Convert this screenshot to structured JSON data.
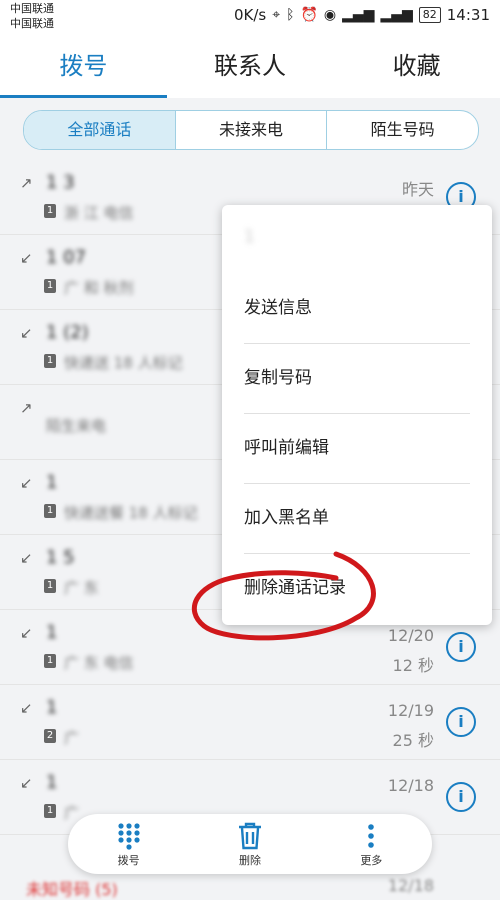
{
  "status_bar": {
    "carrier_1": "中国联通",
    "carrier_2": "中国联通",
    "speed": "0K/s",
    "battery": "82",
    "time": "14:31"
  },
  "tabs": [
    {
      "label": "拨号",
      "active": true
    },
    {
      "label": "联系人",
      "active": false
    },
    {
      "label": "收藏",
      "active": false
    }
  ],
  "filter": [
    {
      "label": "全部通话",
      "active": true
    },
    {
      "label": "未接来电",
      "active": false
    },
    {
      "label": "陌生号码",
      "active": false
    }
  ],
  "calls": [
    {
      "name": "1 3",
      "sim": "1",
      "sub": "浙 江 电信",
      "date": "昨天",
      "duration": ""
    },
    {
      "name": "1 07",
      "sim": "1",
      "sub": "广 和 秋剂",
      "date": "",
      "duration": ""
    },
    {
      "name": "1 (2)",
      "sim": "1",
      "sub": "快递送 18 人标记",
      "date": "",
      "duration": ""
    },
    {
      "name": "",
      "sim": "",
      "sub": "陌生来电",
      "date": "",
      "duration": ""
    },
    {
      "name": "1",
      "sim": "1",
      "sub": "快递送餐 18 人标记",
      "date": "",
      "duration": ""
    },
    {
      "name": "1 5",
      "sim": "1",
      "sub": "广 东",
      "date": "",
      "duration": ""
    },
    {
      "name": "1",
      "sim": "1",
      "sub": "广 东 电信",
      "date": "12/20",
      "duration": "12 秒"
    },
    {
      "name": "1",
      "sim": "2",
      "sub": "广",
      "date": "12/19",
      "duration": "25 秒"
    },
    {
      "name": "1",
      "sim": "1",
      "sub": "广",
      "date": "12/18",
      "duration": ""
    }
  ],
  "context_menu": {
    "header": "1",
    "items": [
      "发送信息",
      "复制号码",
      "呼叫前编辑",
      "加入黑名单",
      "删除通话记录"
    ]
  },
  "toolbar": {
    "dial_label": "拨号",
    "delete_label": "删除",
    "more_label": "更多"
  },
  "peek": {
    "name": "未知号码 (5)",
    "date": "12/18"
  },
  "colors": {
    "accent": "#1a7ec2",
    "annotation": "#d0181b"
  }
}
